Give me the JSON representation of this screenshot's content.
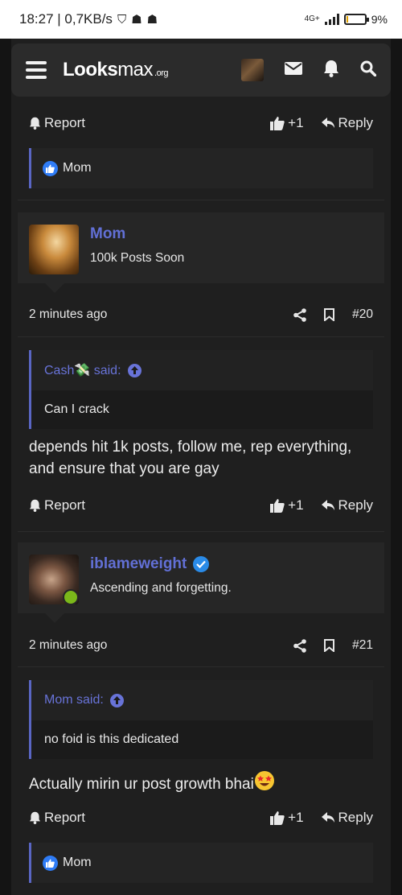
{
  "status_bar": {
    "time_speed": "18:27 | 0,7KB/s",
    "network": "4G+",
    "battery": "9%",
    "battery_level_pct": 9
  },
  "header": {
    "logo_bold": "Looks",
    "logo_thin": "max",
    "logo_suffix": ".org",
    "icons": [
      "menu-icon",
      "avatar",
      "mail-icon",
      "bell-icon",
      "search-icon"
    ]
  },
  "actions": {
    "report": "Report",
    "like": "+1",
    "reply": "Reply"
  },
  "posts": [
    {
      "reaction_user": "Mom"
    },
    {
      "username": "Mom",
      "user_title": "100k Posts Soon",
      "time": "2 minutes ago",
      "number": "#20",
      "quote_author": "Cash💸 said:",
      "quote_text": "Can I crack",
      "text": "depends hit 1k posts, follow me, rep everything, and ensure that you are gay"
    },
    {
      "username": "iblameweight",
      "user_title": "Ascending and forgetting.",
      "time": "2 minutes ago",
      "number": "#21",
      "quote_author": "Mom said:",
      "quote_text": "no foid is this dedicated",
      "text": "Actually mirin ur post growth bhai",
      "reaction_user": "Mom"
    }
  ],
  "colors": {
    "accent": "#6270d6",
    "like_blue": "#2f7cf6",
    "online_green": "#7bb81a",
    "verified_blue": "#2a8be8"
  }
}
